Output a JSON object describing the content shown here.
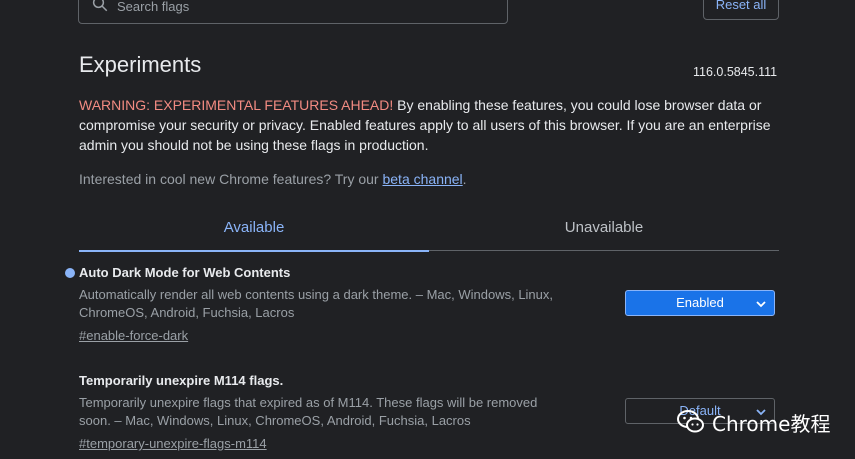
{
  "header": {
    "search_placeholder": "Search flags",
    "reset_label": "Reset all"
  },
  "title": "Experiments",
  "version": "116.0.5845.111",
  "warning": {
    "prefix": "WARNING: EXPERIMENTAL FEATURES AHEAD!",
    "body": " By enabling these features, you could lose browser data or compromise your security or privacy. Enabled features apply to all users of this browser. If you are an enterprise admin you should not be using these flags in production."
  },
  "interested": {
    "text": "Interested in cool new Chrome features? Try our ",
    "link": "beta channel",
    "suffix": "."
  },
  "tabs": [
    {
      "label": "Available",
      "active": true
    },
    {
      "label": "Unavailable",
      "active": false
    }
  ],
  "experiments": [
    {
      "name": "Auto Dark Mode for Web Contents",
      "description": "Automatically render all web contents using a dark theme. – Mac, Windows, Linux, ChromeOS, Android, Fuchsia, Lacros",
      "hash": "#enable-force-dark",
      "selected": "Enabled",
      "modified": true
    },
    {
      "name": "Temporarily unexpire M114 flags.",
      "description": "Temporarily unexpire flags that expired as of M114. These flags will be removed soon. – Mac, Windows, Linux, ChromeOS, Android, Fuchsia, Lacros",
      "hash": "#temporary-unexpire-flags-m114",
      "selected": "Default",
      "modified": false
    }
  ],
  "watermark": {
    "text": "Chrome教程",
    "icon": "wechat-logo"
  },
  "colors": {
    "background": "#202124",
    "accent": "#8ab4f8",
    "warning": "#f28b82",
    "enabled_bg": "#1a73e8"
  }
}
